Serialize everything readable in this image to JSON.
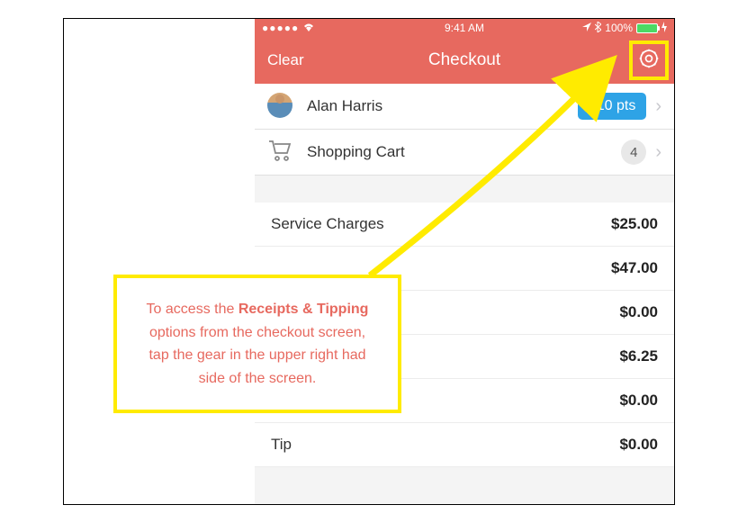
{
  "status": {
    "carrier_dots": "●●●●●",
    "wifi_icon": "wifi",
    "time": "9:41 AM",
    "location_icon": "location",
    "bluetooth_icon": "bluetooth",
    "battery_pct": "100%",
    "charging_icon": "charging"
  },
  "nav": {
    "clear": "Clear",
    "title": "Checkout",
    "gear_icon": "gear"
  },
  "customer": {
    "name": "Alan Harris",
    "points": "310 pts"
  },
  "cart": {
    "label": "Shopping Cart",
    "count": "4"
  },
  "lines": [
    {
      "label": "Service Charges",
      "amount": "$25.00"
    },
    {
      "label": "",
      "amount": "$47.00"
    },
    {
      "label": "",
      "amount": "$0.00"
    },
    {
      "label": "",
      "amount": "$6.25"
    },
    {
      "label": "",
      "amount": "$0.00"
    },
    {
      "label": "Tip",
      "amount": "$0.00"
    }
  ],
  "callout": {
    "prefix": "To access the ",
    "bold": "Receipts & Tipping",
    "suffix": " options from the checkout screen, tap the gear in the upper right had side of the screen."
  }
}
